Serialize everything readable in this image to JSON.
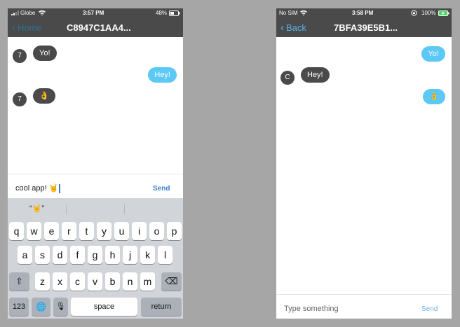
{
  "left": {
    "status": {
      "carrier": "Globe",
      "time": "3:57 PM",
      "battery": "48%"
    },
    "nav": {
      "back_label": "Home",
      "title": "C8947C1AA4..."
    },
    "messages": [
      {
        "direction": "in",
        "avatar": "7",
        "text": "Yo!"
      },
      {
        "direction": "out",
        "text": "Hey!"
      },
      {
        "direction": "in",
        "avatar": "7",
        "text": "👌"
      }
    ],
    "composer": {
      "value": "cool app! 🤘",
      "send_label": "Send"
    },
    "keyboard": {
      "suggestions": [
        "“🤘”",
        "",
        ""
      ],
      "row1": [
        "q",
        "w",
        "e",
        "r",
        "t",
        "y",
        "u",
        "i",
        "o",
        "p"
      ],
      "row2": [
        "a",
        "s",
        "d",
        "f",
        "g",
        "h",
        "j",
        "k",
        "l"
      ],
      "row3": [
        "z",
        "x",
        "c",
        "v",
        "b",
        "n",
        "m"
      ],
      "shift_glyph": "⇧",
      "delete_glyph": "⌫",
      "numbers_label": "123",
      "globe_glyph": "🌐",
      "mic_glyph": "🎙",
      "space_label": "space",
      "return_label": "return"
    }
  },
  "right": {
    "status": {
      "carrier": "No SIM",
      "time": "3:58 PM",
      "battery": "100%"
    },
    "nav": {
      "back_label": "Back",
      "title": "7BFA39E5B1..."
    },
    "messages": [
      {
        "direction": "out",
        "text": "Yo!"
      },
      {
        "direction": "in",
        "avatar": "C",
        "text": "Hey!"
      },
      {
        "direction": "out",
        "text": "👌"
      }
    ],
    "composer": {
      "placeholder": "Type something",
      "send_label": "Send"
    }
  },
  "colors": {
    "bar_background": "#4a4a4a",
    "accent_blue": "#5aaee0",
    "outgoing_bubble": "#5bc8f5",
    "incoming_bubble": "#4a4a4a",
    "battery_green": "#4cd964",
    "keyboard_background": "#d1d4d9"
  }
}
